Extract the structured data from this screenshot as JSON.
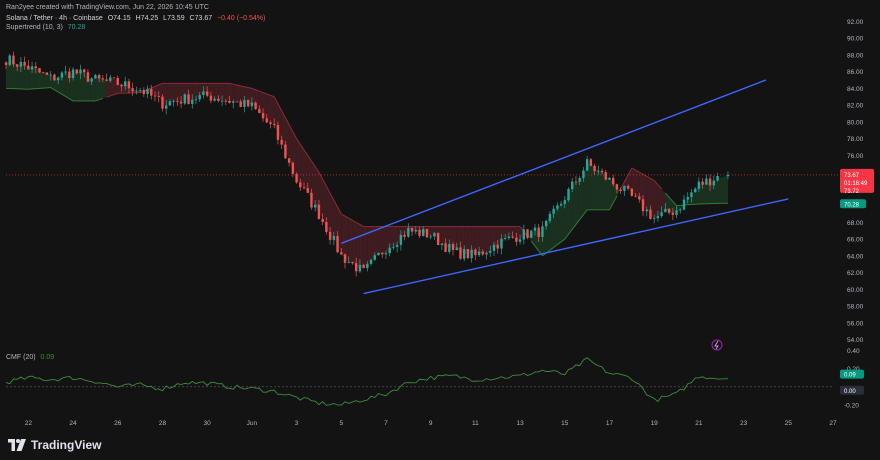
{
  "header": {
    "credit": "Ran2yee created with TradingView.com, Jun 22, 2026 10:45 UTC",
    "symbol": "Solana / Tether · 4h · Coinbase",
    "ohlc": [
      "O74.15",
      "H74.25",
      "L73.59",
      "C73.67",
      "−0.40 (−0.54%)"
    ],
    "indicator_1": "Supertrend (10, 3)",
    "indicator_1_value": "70.28",
    "indicator_2": "CMF (20)",
    "indicator_2_value": "0.09"
  },
  "brand": {
    "name": "TradingView"
  },
  "colors": {
    "background": "#131313",
    "up": "#26a69a",
    "down": "#ef5350",
    "up_fill": "#1e3a24",
    "down_fill": "#4a1f24",
    "channel": "#3e66ff",
    "cmf_line": "#3f8c3a"
  },
  "price_badges": {
    "last": {
      "price": "73.67",
      "countdown": "01:16:49",
      "sub": "73.72",
      "color": "#f23645"
    },
    "supertrend": {
      "price": "70.28",
      "color": "#089981"
    }
  },
  "cmf_badges": [
    {
      "value": "0.09",
      "color": "#089981"
    },
    {
      "value": "0.00",
      "color": "#2a2e39"
    }
  ],
  "chart_data": {
    "type": "line",
    "title": "Solana / Tether · 4h · Coinbase",
    "price_series": {
      "name": "Solana / Tether",
      "x": [
        "May 21",
        "May 22",
        "May 23",
        "May 24",
        "May 25",
        "May 26",
        "May 27",
        "May 28",
        "May 29",
        "May 30",
        "May 31",
        "Jun 1",
        "Jun 2",
        "Jun 3",
        "Jun 4",
        "Jun 5",
        "Jun 6",
        "Jun 7",
        "Jun 8",
        "Jun 9",
        "Jun 10",
        "Jun 11",
        "Jun 12",
        "Jun 13",
        "Jun 14",
        "Jun 15",
        "Jun 16",
        "Jun 17",
        "Jun 18",
        "Jun 19",
        "Jun 20",
        "Jun 21",
        "Jun 22"
      ],
      "close": [
        87.5,
        86.5,
        85.2,
        86.0,
        85.0,
        84.6,
        83.9,
        82.2,
        82.7,
        83.1,
        82.5,
        81.8,
        79.0,
        73.0,
        69.0,
        64.0,
        62.0,
        65.0,
        67.0,
        66.5,
        64.5,
        64.0,
        65.5,
        66.5,
        67.0,
        71.0,
        75.0,
        73.0,
        71.0,
        68.5,
        69.5,
        72.5,
        73.67
      ]
    },
    "supertrend": {
      "name": "Supertrend (10, 3)",
      "x": [
        "May 21",
        "May 22",
        "May 23",
        "May 24",
        "May 25",
        "May 26",
        "May 27",
        "May 28",
        "May 29",
        "May 30",
        "May 31",
        "Jun 1",
        "Jun 2",
        "Jun 3",
        "Jun 4",
        "Jun 5",
        "Jun 6",
        "Jun 7",
        "Jun 8",
        "Jun 9",
        "Jun 10",
        "Jun 11",
        "Jun 12",
        "Jun 13",
        "Jun 14",
        "Jun 15",
        "Jun 16",
        "Jun 17",
        "Jun 18",
        "Jun 19",
        "Jun 20",
        "Jun 21",
        "Jun 22"
      ],
      "value": [
        84.0,
        83.9,
        84.1,
        82.5,
        82.5,
        83.4,
        83.5,
        84.6,
        84.6,
        84.6,
        84.6,
        84.0,
        83.0,
        78.0,
        74.0,
        69.0,
        67.5,
        67.5,
        67.5,
        67.5,
        67.5,
        67.5,
        67.5,
        67.5,
        64.0,
        66.0,
        69.5,
        69.5,
        74.5,
        73.0,
        70.0,
        70.2,
        70.28
      ],
      "trend": [
        "up",
        "up",
        "up",
        "up",
        "up",
        "down",
        "down",
        "down",
        "down",
        "down",
        "down",
        "down",
        "down",
        "down",
        "down",
        "down",
        "down",
        "down",
        "down",
        "down",
        "down",
        "down",
        "down",
        "down",
        "up",
        "up",
        "up",
        "up",
        "down",
        "down",
        "up",
        "up",
        "up"
      ]
    },
    "channel_lines": [
      {
        "name": "upper",
        "from": [
          "Jun 5",
          65.5
        ],
        "to": [
          "Jun 24",
          85.0
        ]
      },
      {
        "name": "lower",
        "from": [
          "Jun 6",
          59.5
        ],
        "to": [
          "Jun 25",
          70.8
        ]
      }
    ],
    "cmf": {
      "name": "CMF (20)",
      "x": [
        "May 21",
        "May 22",
        "May 23",
        "May 24",
        "May 25",
        "May 26",
        "May 27",
        "May 28",
        "May 29",
        "May 30",
        "May 31",
        "Jun 1",
        "Jun 2",
        "Jun 3",
        "Jun 4",
        "Jun 5",
        "Jun 6",
        "Jun 7",
        "Jun 8",
        "Jun 9",
        "Jun 10",
        "Jun 11",
        "Jun 12",
        "Jun 13",
        "Jun 14",
        "Jun 15",
        "Jun 16",
        "Jun 17",
        "Jun 18",
        "Jun 19",
        "Jun 20",
        "Jun 21",
        "Jun 22"
      ],
      "value": [
        0.05,
        0.1,
        0.08,
        0.1,
        0.06,
        0.0,
        0.02,
        -0.02,
        0.05,
        0.04,
        0.0,
        -0.02,
        -0.05,
        -0.12,
        -0.18,
        -0.2,
        -0.14,
        -0.08,
        0.05,
        0.1,
        0.12,
        0.08,
        0.1,
        0.12,
        0.18,
        0.14,
        0.3,
        0.15,
        0.1,
        -0.15,
        -0.08,
        0.12,
        0.09
      ]
    },
    "price_axis": {
      "ylim": [
        53.0,
        93.0
      ],
      "ticks": [
        "92.00",
        "90.00",
        "88.00",
        "86.00",
        "84.00",
        "82.00",
        "80.00",
        "78.00",
        "76.00",
        "74.00",
        "72.00",
        "70.00",
        "68.00",
        "66.00",
        "64.00",
        "62.00",
        "60.00",
        "58.00",
        "56.00",
        "54.00"
      ]
    },
    "cmf_axis": {
      "ylim": [
        -0.3,
        0.45
      ],
      "ticks": [
        "0.40",
        "0.20",
        "-0.20"
      ]
    },
    "x_axis": {
      "domain": [
        "May 21",
        "Jun 27"
      ],
      "ticks": [
        {
          "label": "22",
          "date": "May 22"
        },
        {
          "label": "24",
          "date": "May 24"
        },
        {
          "label": "26",
          "date": "May 26"
        },
        {
          "label": "28",
          "date": "May 28"
        },
        {
          "label": "30",
          "date": "May 30"
        },
        {
          "label": "Jun",
          "date": "Jun 1"
        },
        {
          "label": "3",
          "date": "Jun 3"
        },
        {
          "label": "5",
          "date": "Jun 5"
        },
        {
          "label": "7",
          "date": "Jun 7"
        },
        {
          "label": "9",
          "date": "Jun 9"
        },
        {
          "label": "11",
          "date": "Jun 11"
        },
        {
          "label": "13",
          "date": "Jun 13"
        },
        {
          "label": "15",
          "date": "Jun 15"
        },
        {
          "label": "17",
          "date": "Jun 17"
        },
        {
          "label": "19",
          "date": "Jun 19"
        },
        {
          "label": "21",
          "date": "Jun 21"
        },
        {
          "label": "23",
          "date": "Jun 23"
        },
        {
          "label": "25",
          "date": "Jun 25"
        },
        {
          "label": "27",
          "date": "Jun 27"
        }
      ]
    },
    "grid": false,
    "legend": "top-left"
  }
}
